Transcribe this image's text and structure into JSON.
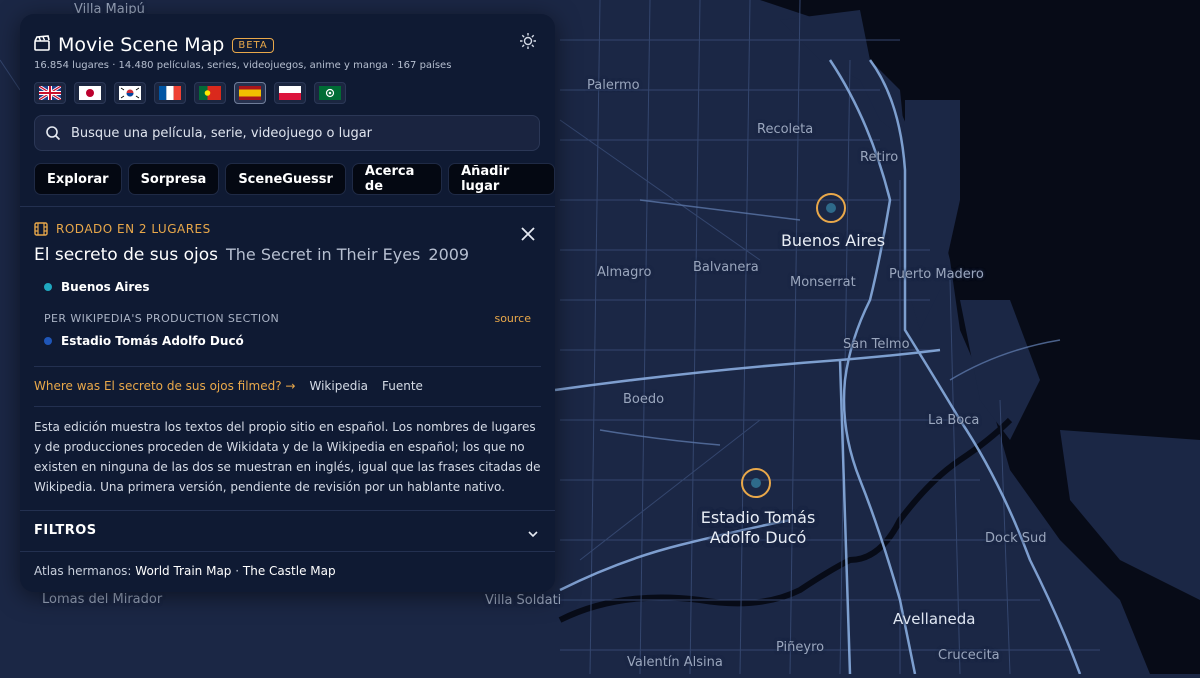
{
  "app": {
    "title": "Movie Scene Map",
    "badge": "BETA",
    "stats": "16.854 lugares · 14.480 películas, series, videojuegos, anime y manga · 167 países"
  },
  "languages": [
    {
      "name": "english-flag-button",
      "selected": false
    },
    {
      "name": "japanese-flag-button",
      "selected": false
    },
    {
      "name": "korean-flag-button",
      "selected": false
    },
    {
      "name": "french-flag-button",
      "selected": false
    },
    {
      "name": "portuguese-flag-button",
      "selected": false
    },
    {
      "name": "spanish-flag-button",
      "selected": true
    },
    {
      "name": "polish-flag-button",
      "selected": false
    },
    {
      "name": "arabic-flag-button",
      "selected": false
    }
  ],
  "search": {
    "placeholder": "Busque una película, serie, videojuego o lugar"
  },
  "nav": [
    "Explorar",
    "Sorpresa",
    "SceneGuessr",
    "Acerca de",
    "Añadir lugar"
  ],
  "detail": {
    "filmed_label": "RODADO EN 2 LUGARES",
    "title": "El secreto de sus ojos",
    "original_title": "The Secret in Their Eyes",
    "year": "2009",
    "location1": "Buenos Aires",
    "section_label": "PER WIKIPEDIA'S PRODUCTION SECTION",
    "source_label": "source",
    "location2": "Estadio Tomás Adolfo Ducó",
    "where_link": "Where was El secreto de sus ojos filmed? →",
    "wikipedia_link": "Wikipedia",
    "fuente_link": "Fuente",
    "description": "Esta edición muestra los textos del propio sitio en español. Los nombres de lugares y de producciones proceden de Wikidata y de la Wikipedia en español; los que no existen en ninguna de las dos se muestran en inglés, igual que las frases citadas de Wikipedia. Una primera versión, pendiente de revisión por un hablante nativo."
  },
  "filters": {
    "label": "FILTROS"
  },
  "footer": {
    "prefix": "Atlas hermanos:",
    "link1": "World Train Map",
    "separator": "·",
    "link2": "The Castle Map"
  },
  "map": {
    "labels": [
      "Villa Maipú",
      "Palermo",
      "Recoleta",
      "Retiro",
      "Almagro",
      "Balvanera",
      "Monserrat",
      "Puerto Madero",
      "San Telmo",
      "Boedo",
      "La Boca",
      "Dock Sud",
      "Lomas del Mirador",
      "Villa Soldati",
      "Avellaneda",
      "Piñeyro",
      "Valentín Alsina",
      "Crucecita"
    ],
    "pins": [
      {
        "label": "Buenos Aires"
      },
      {
        "label": "Estadio Tomás Adolfo Ducó"
      }
    ]
  },
  "colors": {
    "accent": "#e9a84a",
    "panel": "#0f1a33",
    "map_bg": "#1b2745",
    "road": "#8fb4e8",
    "water": "#070b17"
  }
}
